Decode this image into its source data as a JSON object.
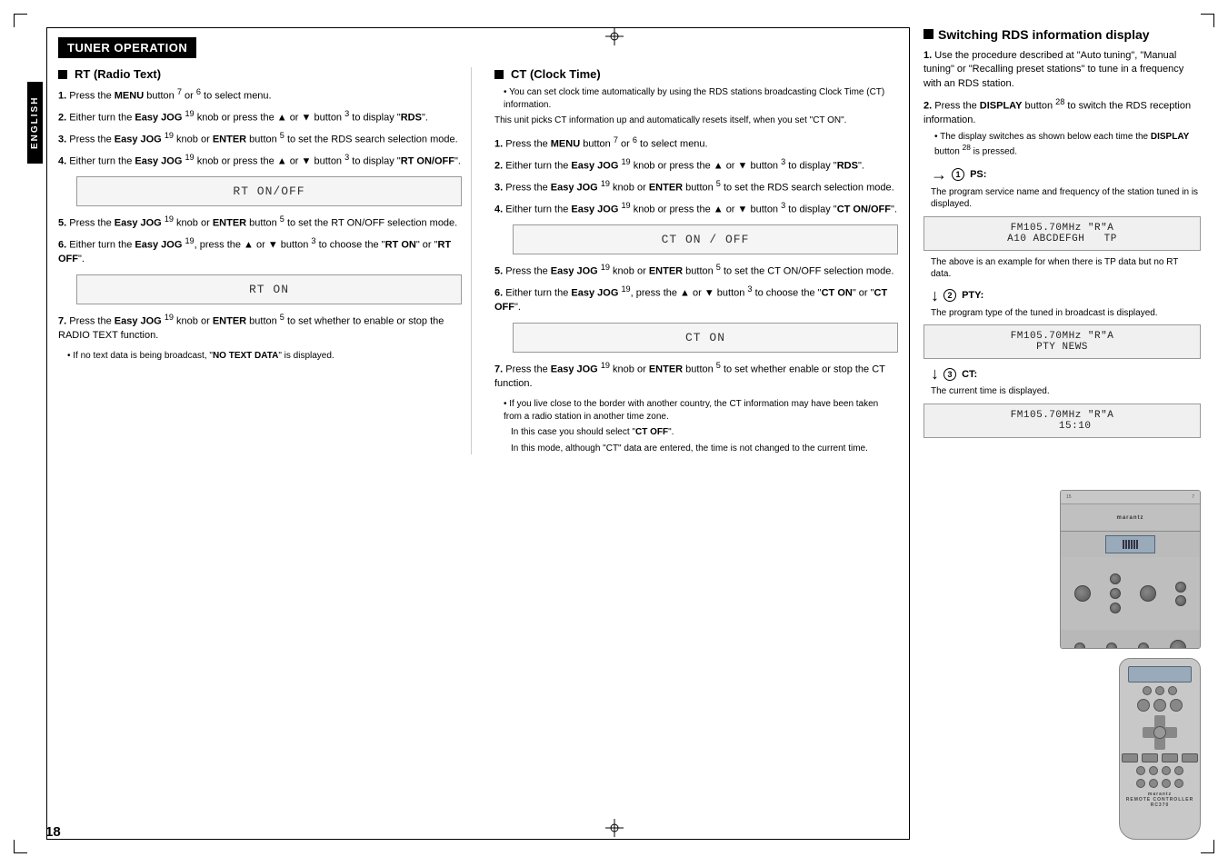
{
  "page": {
    "number": "18",
    "corner_marks": true,
    "crosshairs": true
  },
  "section": {
    "title": "TUNER OPERATION",
    "english_label": "ENGLISH"
  },
  "rt_section": {
    "title": "RT (Radio Text)",
    "steps": [
      {
        "num": "1.",
        "text": "Press the ",
        "bold": "MENU",
        "text2": " button ",
        "sup1": "7",
        "text3": " or ",
        "sup2": "6",
        "text4": " to select menu."
      },
      {
        "num": "2.",
        "text": "Either turn the ",
        "bold": "Easy JOG",
        "text2": " ",
        "sup1": "19",
        "text3": " knob or press the ▲ or ▼ button ",
        "sup2": "3",
        "text4": " to display \"RDS\"."
      },
      {
        "num": "3.",
        "text": "Press the ",
        "bold": "Easy JOG",
        "text2": " ",
        "sup1": "19",
        "text3": " knob or ",
        "bold2": "ENTER",
        "text4": " button ",
        "sup2": "5",
        "text5": " to set the RDS search selection mode."
      },
      {
        "num": "4.",
        "text": "Either turn the ",
        "bold": "Easy JOG",
        "text2": " ",
        "sup1": "19",
        "text3": " knob or press the ▲ or ▼ button ",
        "sup2": "3",
        "text4": " to display \"RT ON/OFF\"."
      }
    ],
    "display1": "RT ON/OFF",
    "steps2": [
      {
        "num": "5.",
        "text": "Press the ",
        "bold": "Easy JOG",
        "text2": " ",
        "sup1": "19",
        "text3": " knob or ",
        "bold2": "ENTER",
        "text4": " button ",
        "sup2": "5",
        "text5": " to set the RT ON/OFF selection mode."
      },
      {
        "num": "6.",
        "text": "Either turn the ",
        "bold": "Easy JOG",
        "text2": " ",
        "sup1": "19",
        "text3": ", press the ▲ or ▼ button ",
        "sup2": "3",
        "text4": " to choose the \"RT ON\" or \"RT OFF\"."
      }
    ],
    "display2": "RT ON",
    "steps3": [
      {
        "num": "7.",
        "text": "Press the ",
        "bold": "Easy JOG",
        "text2": " ",
        "sup1": "19",
        "text3": " knob or ",
        "bold2": "ENTER",
        "text4": " button ",
        "sup2": "5",
        "text5": " to set whether to enable or stop the RADIO TEXT function."
      }
    ],
    "note": "• If no text data is being broadcast, \"NO TEXT DATA\" is displayed."
  },
  "ct_section": {
    "title": "CT (Clock Time)",
    "intro": "• You can set clock time automatically by using the RDS stations broadcasting Clock Time (CT) information.",
    "intro2": "This unit picks CT information up and automatically resets itself, when you set \"CT ON\".",
    "steps": [
      {
        "num": "1.",
        "text": "Press the ",
        "bold": "MENU",
        "text2": " button ",
        "sup1": "7",
        "text3": " or ",
        "sup2": "6",
        "text4": " to select menu."
      },
      {
        "num": "2.",
        "text": "Either turn the ",
        "bold": "Easy JOG",
        "text2": " ",
        "sup1": "19",
        "text3": " knob or press the ▲ or ▼ button ",
        "sup2": "3",
        "text4": " to display \"RDS\"."
      },
      {
        "num": "3.",
        "text": "Press the ",
        "bold": "Easy JOG",
        "text2": " ",
        "sup1": "19",
        "text3": " knob or ",
        "bold2": "ENTER",
        "text4": " button ",
        "sup2": "5",
        "text5": " to set the RDS search selection mode."
      },
      {
        "num": "4.",
        "text": "Either turn the ",
        "bold": "Easy JOG",
        "text2": " ",
        "sup1": "19",
        "text3": " knob or press the ▲ or ▼ button ",
        "sup2": "3",
        "text4": " to display \"CT ON/OFF\"."
      }
    ],
    "display1": "CT ON / OFF",
    "steps2": [
      {
        "num": "5.",
        "text": "Press the ",
        "bold": "Easy JOG",
        "text2": " ",
        "sup1": "19",
        "text3": " knob or ",
        "bold2": "ENTER",
        "text4": " button ",
        "sup2": "5",
        "text5": " to set the CT ON/OFF selection mode."
      },
      {
        "num": "6.",
        "text": "Either turn the ",
        "bold": "Easy JOG",
        "text2": " ",
        "sup1": "19",
        "text3": ", press the ▲ or ▼ button ",
        "sup2": "3",
        "text4": " to choose the \"CT ON\" or \"CT OFF\"."
      }
    ],
    "display2": "CT ON",
    "steps3": [
      {
        "num": "7.",
        "text": "Press the ",
        "bold": "Easy JOG",
        "text2": " ",
        "sup1": "19",
        "text3": " knob or ",
        "bold2": "ENTER",
        "text4": " button ",
        "sup2": "5",
        "text5": " to set whether enable or stop the CT function."
      }
    ],
    "note1": "• If you live close to the border with another country, the CT information may have been taken from a radio station in another time zone.",
    "note2": "In this case you should select \"CT OFF\".",
    "note3": "In this mode, although \"CT\" data are entered, the time is not changed to the current time."
  },
  "switching_section": {
    "title": "Switching RDS information display",
    "steps": [
      {
        "num": "1.",
        "text": "Use the procedure described at \"Auto tuning\", \"Manual tuning\" or \"Recalling preset stations\" to tune in a frequency with an RDS station."
      },
      {
        "num": "2.",
        "text": "Press the ",
        "bold": "DISPLAY",
        "text2": " button ",
        "sup": "28",
        "text3": " to switch the RDS reception information.",
        "bullet": "• The display switches as shown below each time the ",
        "bold2": "DISPLAY",
        "text4": " button ",
        "sup2": "28",
        "text5": " is pressed."
      }
    ],
    "ps_label": "❶ PS:",
    "ps_desc": "The program service name and frequency of the station tuned in is displayed.",
    "ps_display": "FM105.70MHz  \"R\"A\nA10 ABCDEFGH   TP",
    "ps_note": "The above is an example for when there is TP data but no RT data.",
    "pty_label": "❷ PTY:",
    "pty_desc": "The program type of the tuned in broadcast is displayed.",
    "pty_display": "FM105.70MHz  \"R\"A\nPTY NEWS",
    "ct_label": "❸ CT:",
    "ct_desc": "The current time is displayed.",
    "ct_display": "FM105.70MHz  \"R\"A\n    15:10"
  },
  "device_labels": {
    "receiver": "marantz",
    "remote": "marantz\nREMOTE CONTROLLER\nRC370"
  }
}
